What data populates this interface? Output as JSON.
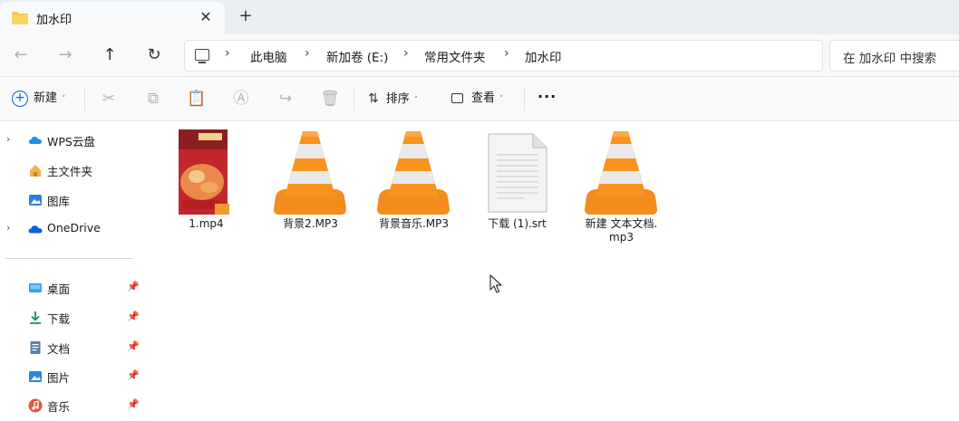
{
  "tab": {
    "title": "加水印",
    "close_glyph": "✕",
    "new_glyph": "+"
  },
  "nav": {
    "back": "←",
    "forward": "→",
    "up": "↑",
    "refresh": "↻"
  },
  "breadcrumb": [
    "此电脑",
    "新加卷 (E:)",
    "常用文件夹",
    "加水印"
  ],
  "breadcrumb_sep": "›",
  "search": {
    "placeholder": "在 加水印 中搜索"
  },
  "toolbar": {
    "new_label": "新建",
    "sort_label": "排序",
    "view_label": "查看",
    "more_label": "···",
    "caret": "˅"
  },
  "sidebar": {
    "chevron": "›",
    "pin": "📌",
    "items": [
      {
        "label": "WPS云盘",
        "icon": "cloud-icon",
        "expandable": true
      },
      {
        "label": "主文件夹",
        "icon": "home-icon",
        "expandable": false
      },
      {
        "label": "图库",
        "icon": "gallery-icon",
        "expandable": false
      },
      {
        "label": "OneDrive",
        "icon": "onedrive-icon",
        "expandable": true
      }
    ],
    "pinned": [
      {
        "label": "桌面",
        "icon": "desktop-icon"
      },
      {
        "label": "下载",
        "icon": "download-icon"
      },
      {
        "label": "文档",
        "icon": "documents-icon"
      },
      {
        "label": "图片",
        "icon": "pictures-icon"
      },
      {
        "label": "音乐",
        "icon": "music-icon"
      }
    ]
  },
  "files": [
    {
      "name": "1.mp4",
      "type": "video-thumbnail"
    },
    {
      "name": "背景2.MP3",
      "type": "vlc"
    },
    {
      "name": "背景音乐.MP3",
      "type": "vlc"
    },
    {
      "name": "下载 (1).srt",
      "type": "text"
    },
    {
      "name": "新建 文本文档.\nmp3",
      "type": "vlc"
    }
  ],
  "colors": {
    "accent": "#0067c0",
    "folder": "#f7c948",
    "vlc_orange": "#f28c1c"
  }
}
